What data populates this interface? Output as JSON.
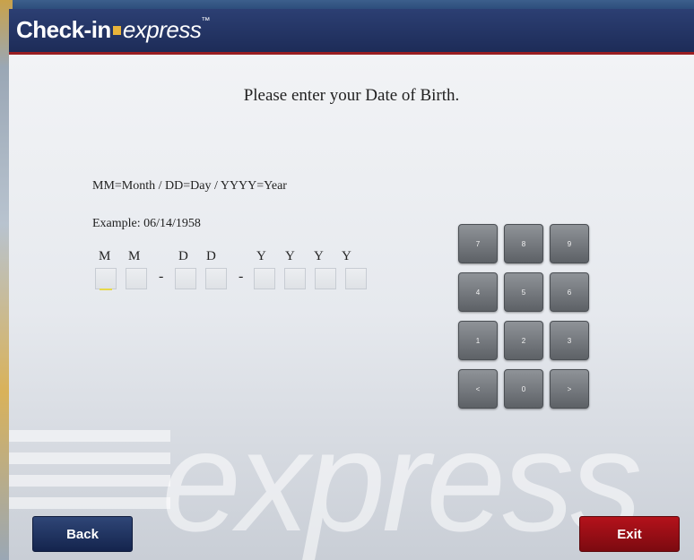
{
  "header": {
    "brand_main": "Check-in",
    "brand_sub": "express",
    "brand_mark": "™"
  },
  "main": {
    "heading": "Please enter your Date of Birth.",
    "format_hint": "MM=Month / DD=Day / YYYY=Year",
    "example": "Example: 06/14/1958",
    "field_letters": [
      "M",
      "M",
      "D",
      "D",
      "Y",
      "Y",
      "Y",
      "Y"
    ],
    "separator": "-",
    "date_values": [
      "",
      "",
      "",
      "",
      "",
      "",
      "",
      ""
    ]
  },
  "keypad": {
    "keys": [
      "7",
      "8",
      "9",
      "4",
      "5",
      "6",
      "1",
      "2",
      "3",
      "<",
      "0",
      ">"
    ]
  },
  "watermark": "express",
  "footer": {
    "back_label": "Back",
    "exit_label": "Exit"
  },
  "colors": {
    "header_bg": "#1d2c58",
    "accent_red": "#9a1e22",
    "brand_yellow": "#e8b33a",
    "back_button": "#1f3264",
    "exit_button": "#9e0f17"
  }
}
